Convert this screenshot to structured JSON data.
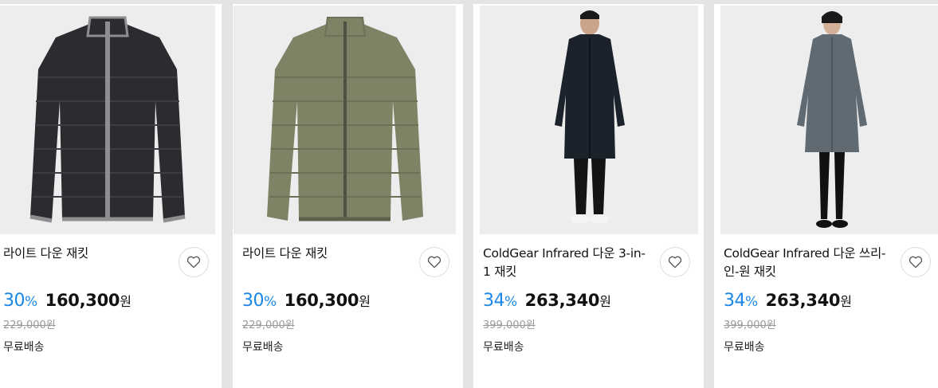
{
  "products": [
    {
      "name": "라이트 다운 재킷",
      "discount": "30",
      "discount_unit": "%",
      "price": "160,300",
      "currency": "원",
      "original_price": "229,000원",
      "shipping": "무료배송",
      "image": "black-puffer-jacket",
      "colors": {
        "body": "#2a2c30",
        "trim": "#8c8e90"
      }
    },
    {
      "name": "라이트 다운 재킷",
      "discount": "30",
      "discount_unit": "%",
      "price": "160,300",
      "currency": "원",
      "original_price": "229,000원",
      "shipping": "무료배송",
      "image": "olive-puffer-jacket",
      "colors": {
        "body": "#7d8466",
        "trim": "#4e5244"
      }
    },
    {
      "name": "ColdGear Infrared 다운 3-in-1 재킷",
      "discount": "34",
      "discount_unit": "%",
      "price": "263,340",
      "currency": "원",
      "original_price": "399,000원",
      "shipping": "무료배송",
      "image": "male-model-black-long-coat",
      "colors": {
        "body": "#1c222c",
        "trim": "#111111"
      }
    },
    {
      "name": "ColdGear Infrared 다운 쓰리-인-원 재킷",
      "discount": "34",
      "discount_unit": "%",
      "price": "263,340",
      "currency": "원",
      "original_price": "399,000원",
      "shipping": "무료배송",
      "image": "female-model-grey-long-coat",
      "colors": {
        "body": "#5f6a72",
        "trim": "#111111"
      }
    }
  ],
  "accent_color": "#1a87e8"
}
